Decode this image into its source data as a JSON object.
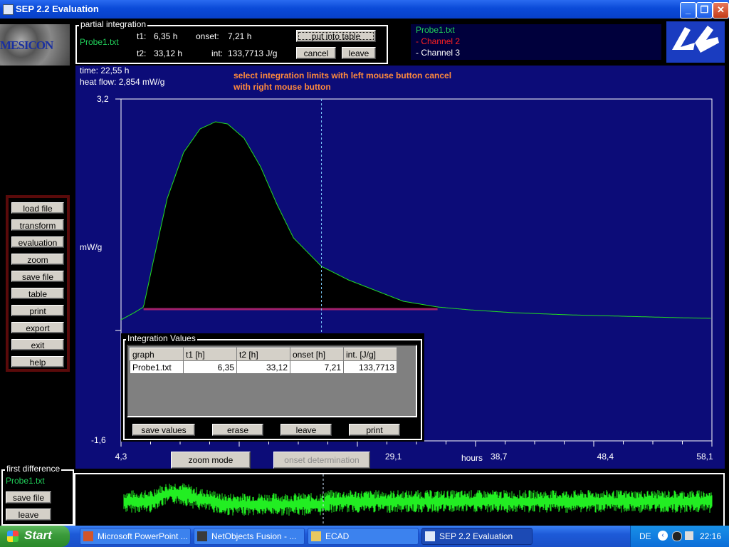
{
  "window": {
    "title": "SEP 2.2 Evaluation"
  },
  "logo_left": {
    "text": "MESICON"
  },
  "partial_integration": {
    "label": "partial integration",
    "file": "Probe1.txt",
    "t1_label": "t1:",
    "t1_value": "6,35 h",
    "t2_label": "t2:",
    "t2_value": "33,12 h",
    "onset_label": "onset:",
    "onset_value": "7,21 h",
    "int_label": "int:",
    "int_value": "133,7713 J/g",
    "put_into_table": "put into table",
    "cancel": "cancel",
    "leave": "leave"
  },
  "channels": [
    {
      "label": "Probe1.txt",
      "color": "#21d05a"
    },
    {
      "label": "- Channel 2",
      "color": "#ff2020"
    },
    {
      "label": "- Channel 3",
      "color": "#ffffff"
    }
  ],
  "readout": {
    "time": "time: 22,55 h",
    "heat_flow": "heat flow: 2,854 mW/g"
  },
  "instruction": {
    "line1": "select integration limits with left mouse button cancel",
    "line2": "with right mouse button"
  },
  "menu": [
    "load file",
    "transform",
    "evaluation",
    "zoom",
    "save file",
    "table",
    "print",
    "export",
    "exit",
    "help"
  ],
  "chart_data": {
    "type": "area",
    "ylabel": "mW/g",
    "xlabel": "hours",
    "y_top_label": "3,2",
    "y_bottom_label": "-1,6",
    "x_ticks": [
      "4,3",
      "29,1",
      "38,7",
      "48,4",
      "58,1"
    ],
    "xlim": [
      4.3,
      58.1
    ],
    "ylim": [
      -1.6,
      3.2
    ],
    "series": [
      {
        "x": [
          4.3,
          5.5,
          6.35,
          7.21,
          8.5,
          10,
          11.5,
          12.9,
          14,
          15.5,
          17,
          18.5,
          20,
          22.55,
          25,
          28,
          30,
          33.12,
          36,
          40,
          45,
          50,
          55,
          58.1
        ],
        "y": [
          0.1,
          0.2,
          0.28,
          0.9,
          1.8,
          2.45,
          2.78,
          2.88,
          2.85,
          2.65,
          2.25,
          1.72,
          1.25,
          0.85,
          0.66,
          0.48,
          0.36,
          0.28,
          0.24,
          0.2,
          0.17,
          0.15,
          0.13,
          0.12
        ]
      }
    ],
    "integration": {
      "t1": 6.35,
      "t2": 33.12
    },
    "cursor_x": 22.55,
    "colors": {
      "plot_bg": "#0c0c78",
      "line": "#22dd22",
      "fill": "#000000",
      "baseline": "#a0206c"
    }
  },
  "integration_values": {
    "label": "Integration Values",
    "headers": [
      "graph",
      "t1 [h]",
      "t2 [h]",
      "onset [h]",
      "int. [J/g]"
    ],
    "rows": [
      [
        "Probe1.txt",
        "6,35",
        "33,12",
        "7,21",
        "133,7713"
      ]
    ],
    "buttons": [
      "save values",
      "erase",
      "leave",
      "print"
    ]
  },
  "bottom_buttons": {
    "zoom_mode": "zoom mode",
    "onset_determination": "onset determination"
  },
  "first_difference": {
    "label": "first difference",
    "file": "Probe1.txt",
    "save_file": "save file",
    "leave": "leave"
  },
  "taskbar": {
    "start": "Start",
    "tasks": [
      "Microsoft PowerPoint ...",
      "NetObjects Fusion - ...",
      "ECAD",
      "SEP 2.2 Evaluation"
    ],
    "lang": "DE",
    "clock": "22:16"
  }
}
